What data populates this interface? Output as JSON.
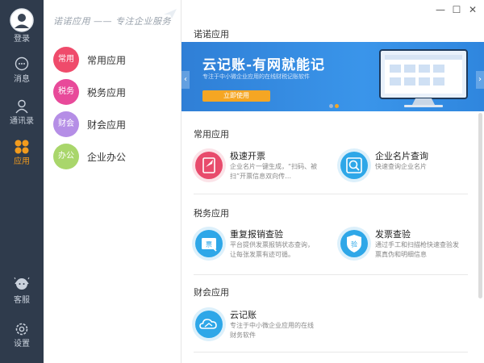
{
  "nav": {
    "login": "登录",
    "messages": "消息",
    "contacts": "通讯录",
    "apps": "应用",
    "service": "客服",
    "settings": "设置"
  },
  "slogan": "诺诺应用 —— 专注企业服务",
  "categories": [
    {
      "badge": "常用",
      "label": "常用应用",
      "color": "#ef4b6b"
    },
    {
      "badge": "税务",
      "label": "税务应用",
      "color": "#e84a9a"
    },
    {
      "badge": "财会",
      "label": "财会应用",
      "color": "#b58ee6"
    },
    {
      "badge": "办公",
      "label": "企业办公",
      "color": "#a9d66b"
    }
  ],
  "main": {
    "header": "诺诺应用",
    "banner": {
      "title": "云记账-有网就能记",
      "subtitle": "专注于中小微企业应用的在线财税记账软件",
      "button": "立即使用"
    },
    "sections": [
      {
        "title": "常用应用",
        "apps": [
          {
            "name": "极速开票",
            "desc": "企业名片一键生成，“扫码、被扫”开票信息双向传…",
            "icon": "invoice-rocket-icon",
            "color": "#e84b6c"
          },
          {
            "name": "企业名片查询",
            "desc": "快速查询企业名片",
            "icon": "search-card-icon",
            "color": "#2ea7e8"
          }
        ]
      },
      {
        "title": "税务应用",
        "apps": [
          {
            "name": "重复报销查验",
            "desc": "平台提供发票报销状态查询，让每张发票有迹可循。",
            "icon": "ticket-check-icon",
            "color": "#2ea7e8"
          },
          {
            "name": "发票查验",
            "desc": "通过手工和扫描枪快速查验发票真伪和明细信息",
            "icon": "shield-verify-icon",
            "color": "#2ea7e8"
          }
        ]
      },
      {
        "title": "财会应用",
        "apps": [
          {
            "name": "云记账",
            "desc": "专注于中小微企业应用的在线财务软件",
            "icon": "cloud-ledger-icon",
            "color": "#2ea7e8"
          }
        ]
      }
    ]
  },
  "window": {
    "minimize": "—",
    "maximize": "☐",
    "close": "✕"
  }
}
